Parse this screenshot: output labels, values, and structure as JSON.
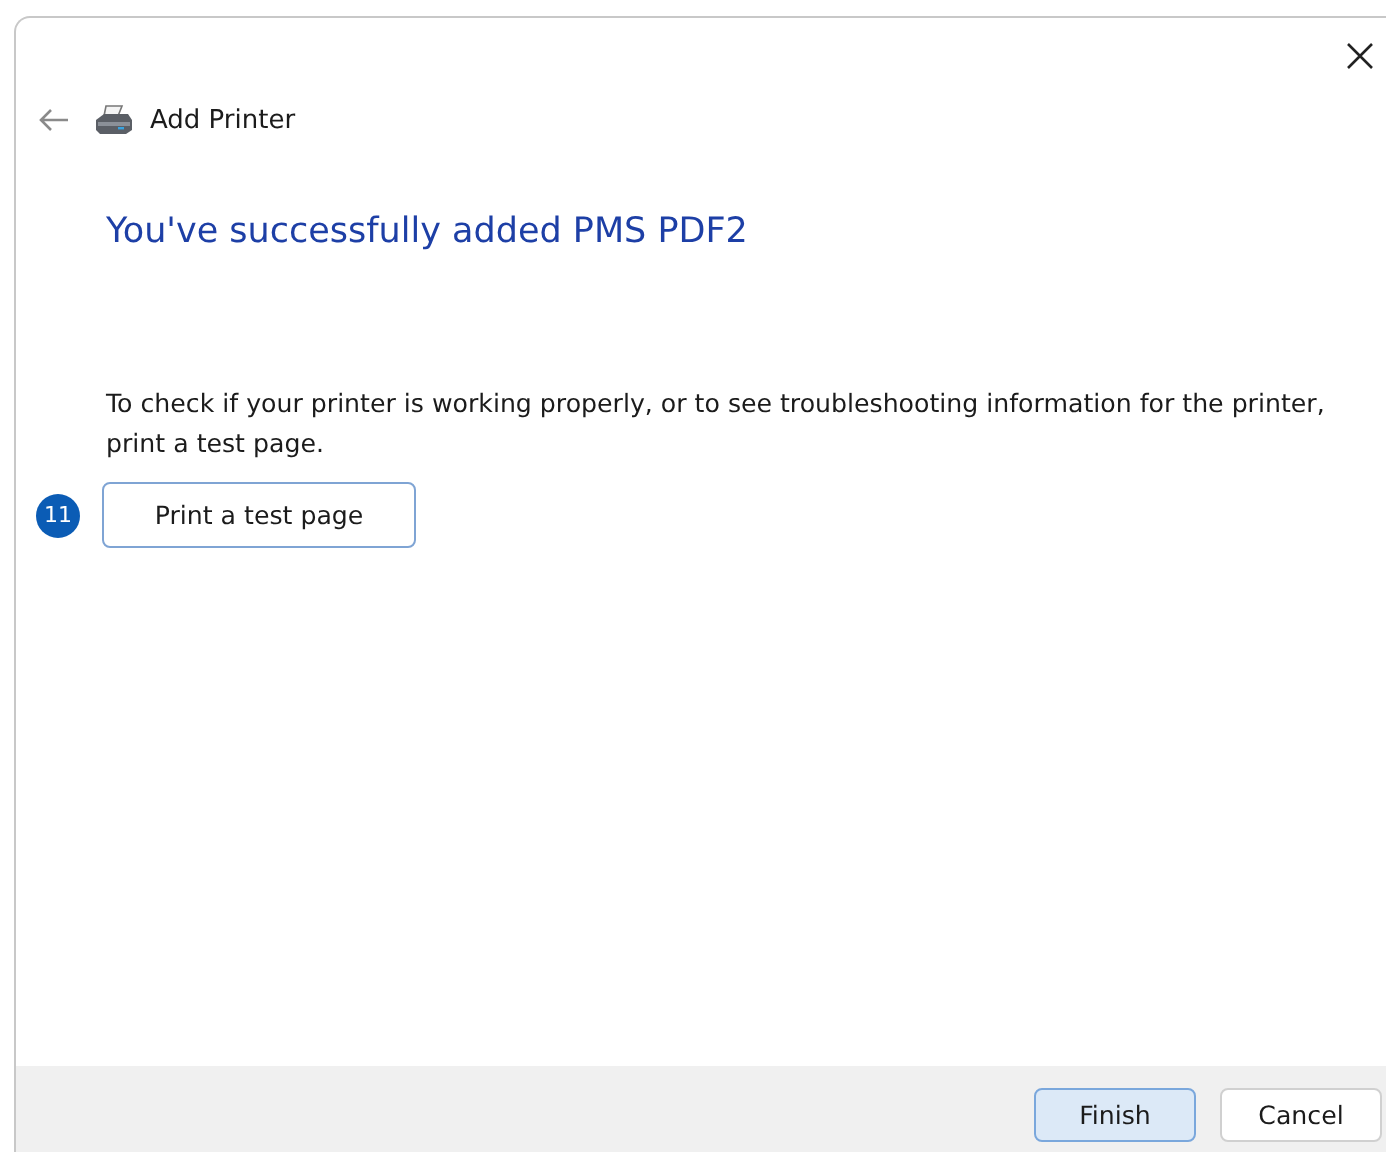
{
  "window": {
    "title": "Add Printer"
  },
  "heading": "You've successfully added PMS PDF2",
  "description": "To check if your printer is working properly, or to see troubleshooting information for the printer, print a test page.",
  "step_badge": "11",
  "test_button": "Print a test page",
  "buttons": [
    {
      "label": "Finish",
      "kind": "primary"
    },
    {
      "label": "Cancel",
      "kind": "secondary"
    }
  ]
}
